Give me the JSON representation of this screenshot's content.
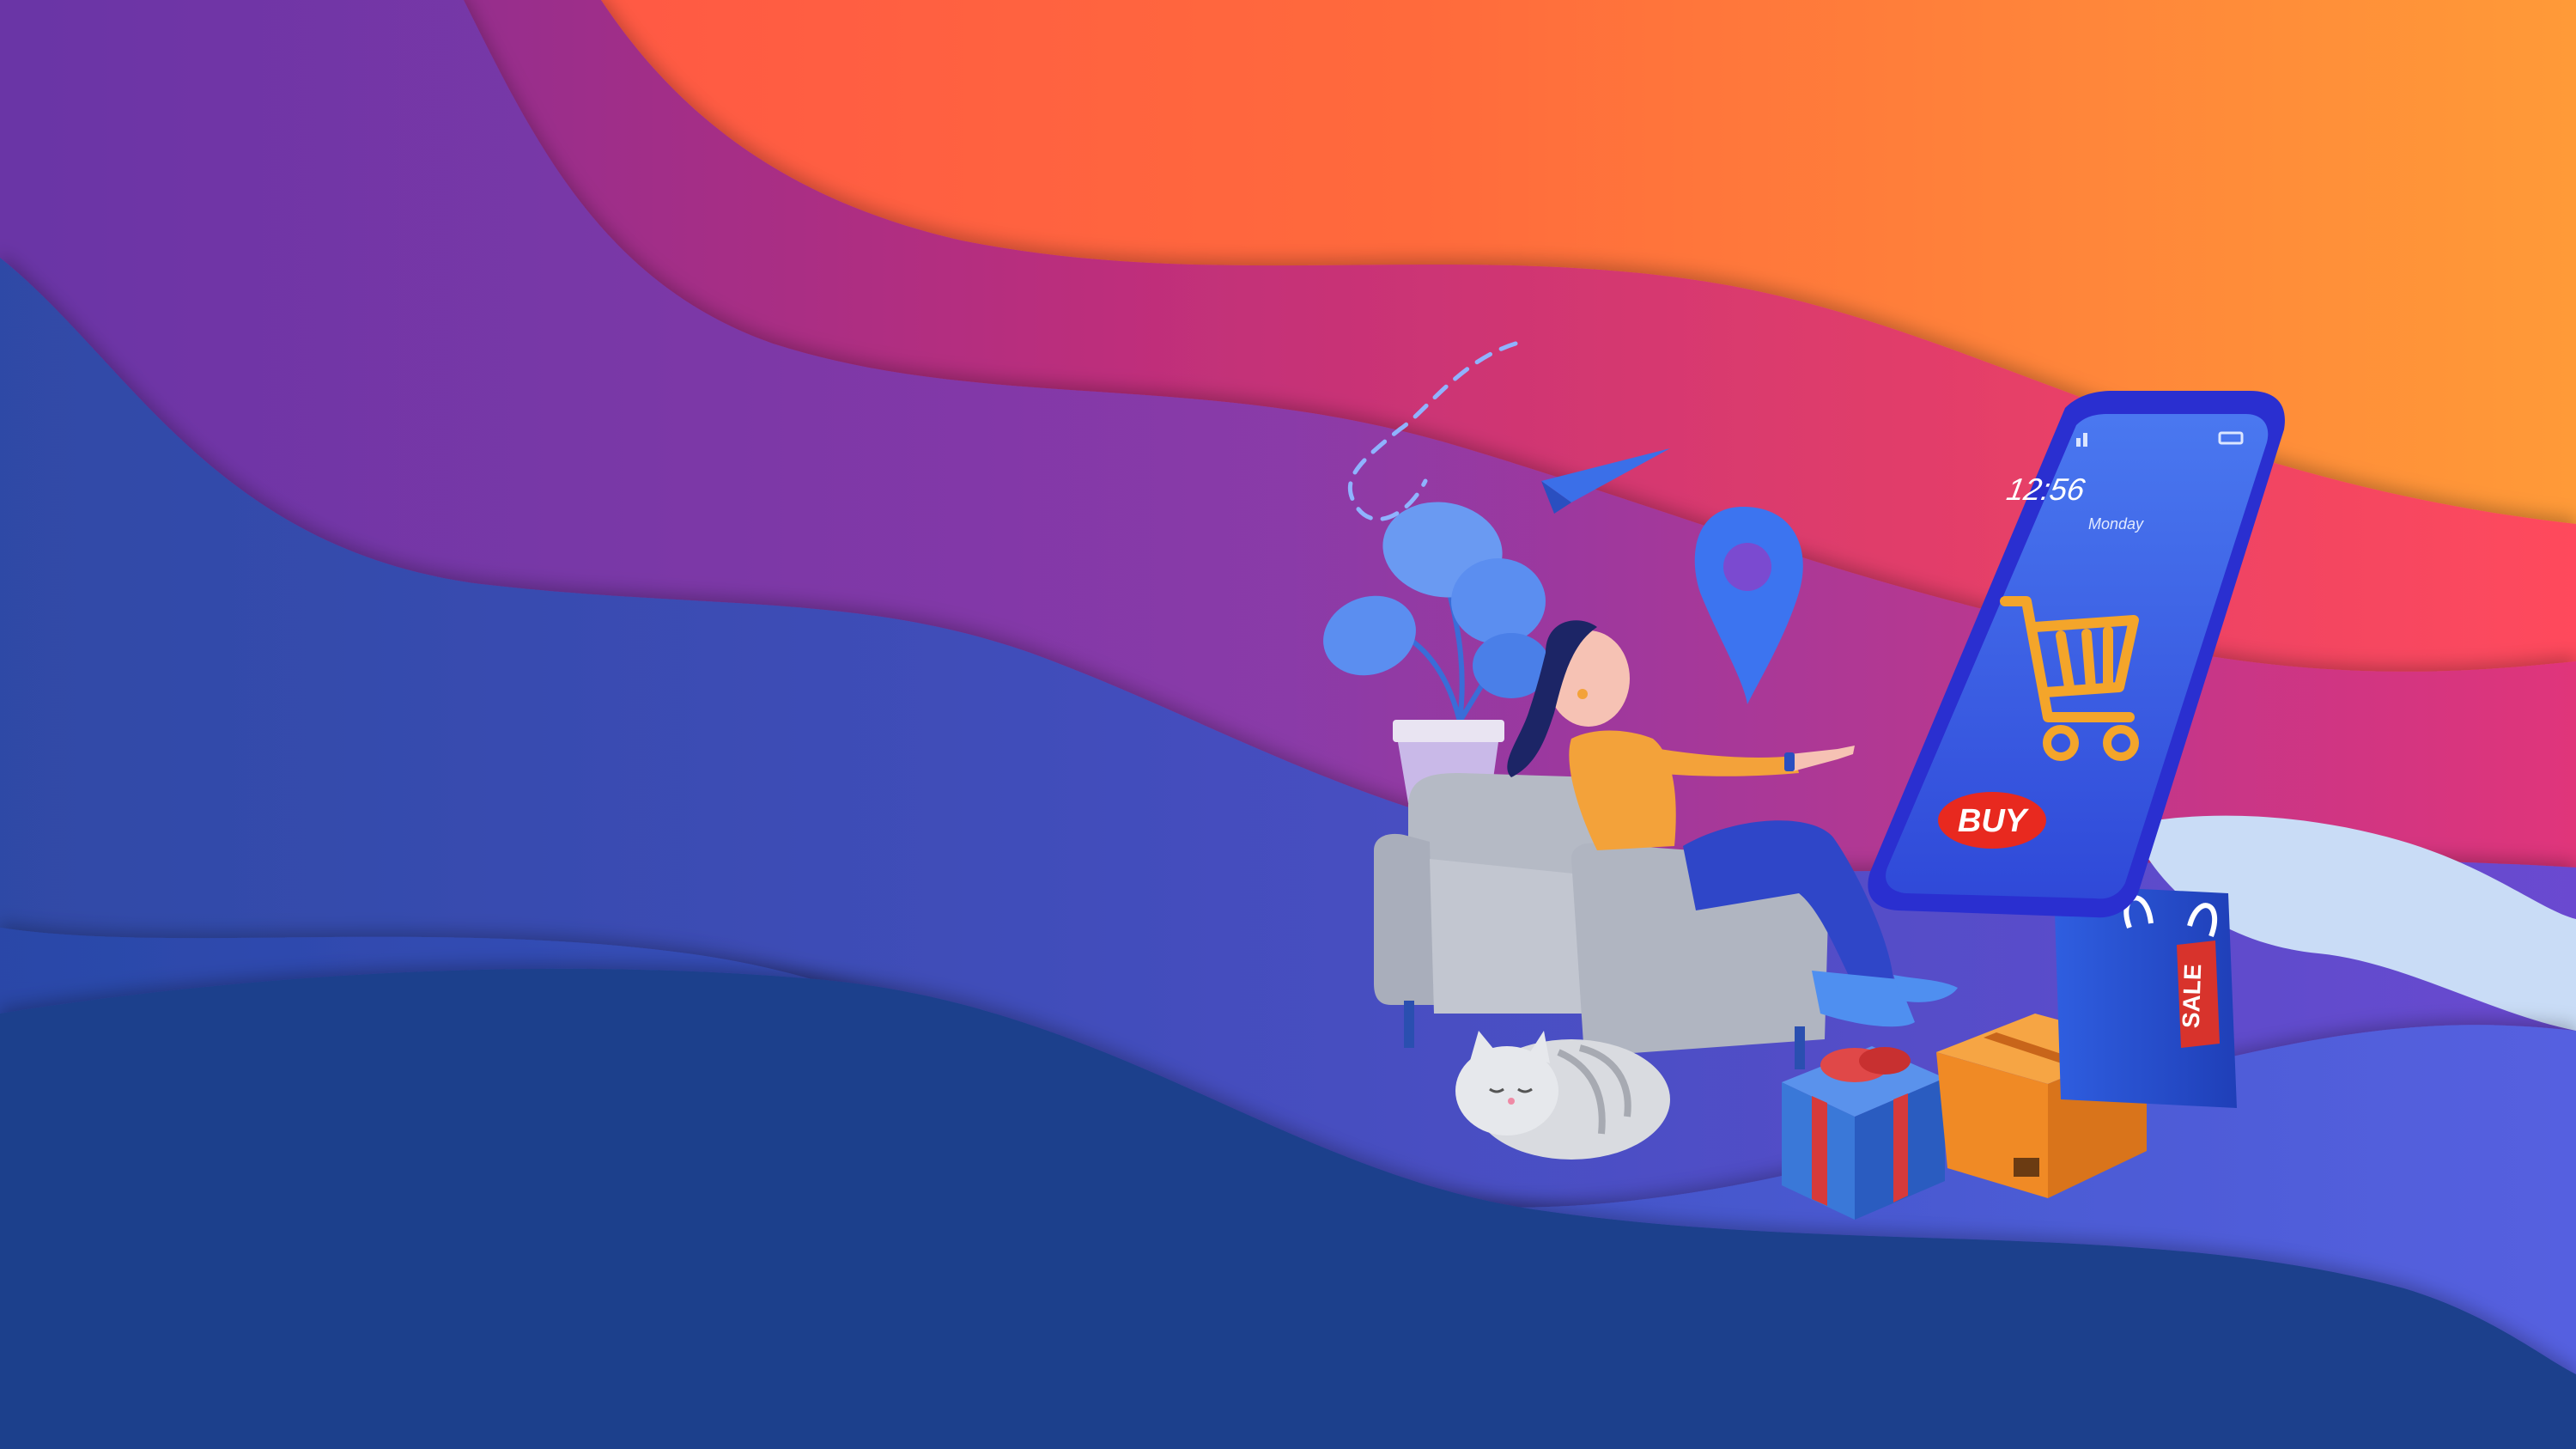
{
  "colors": {
    "navy": "#1e3f8c",
    "indigo": "#3e4fb8",
    "violet": "#7a3aa8",
    "magenta": "#d8356e",
    "red": "#ff5a45",
    "orange": "#ff8a3a",
    "phone_body": "#2a2fd0",
    "phone_screen": "#3f63e6",
    "cart": "#f4a52a",
    "buy_button": "#e8291f",
    "chair": "#b8bcc6",
    "gift_box": "#2e6ac9",
    "gift_ribbon": "#d73a3a",
    "parcel": "#f08a25",
    "sale_tag": "#d8332c"
  },
  "phone": {
    "time": "12:56",
    "day": "Monday",
    "buy_label": "BUY"
  },
  "shopping_bag": {
    "tag_label": "SALE"
  },
  "icons": [
    "plant-icon",
    "location-pin-icon",
    "paper-plane-icon",
    "cart-icon",
    "cat-icon",
    "gift-box-icon",
    "parcel-box-icon",
    "shopping-bag-icon",
    "armchair-icon",
    "signal-icon",
    "battery-icon"
  ]
}
